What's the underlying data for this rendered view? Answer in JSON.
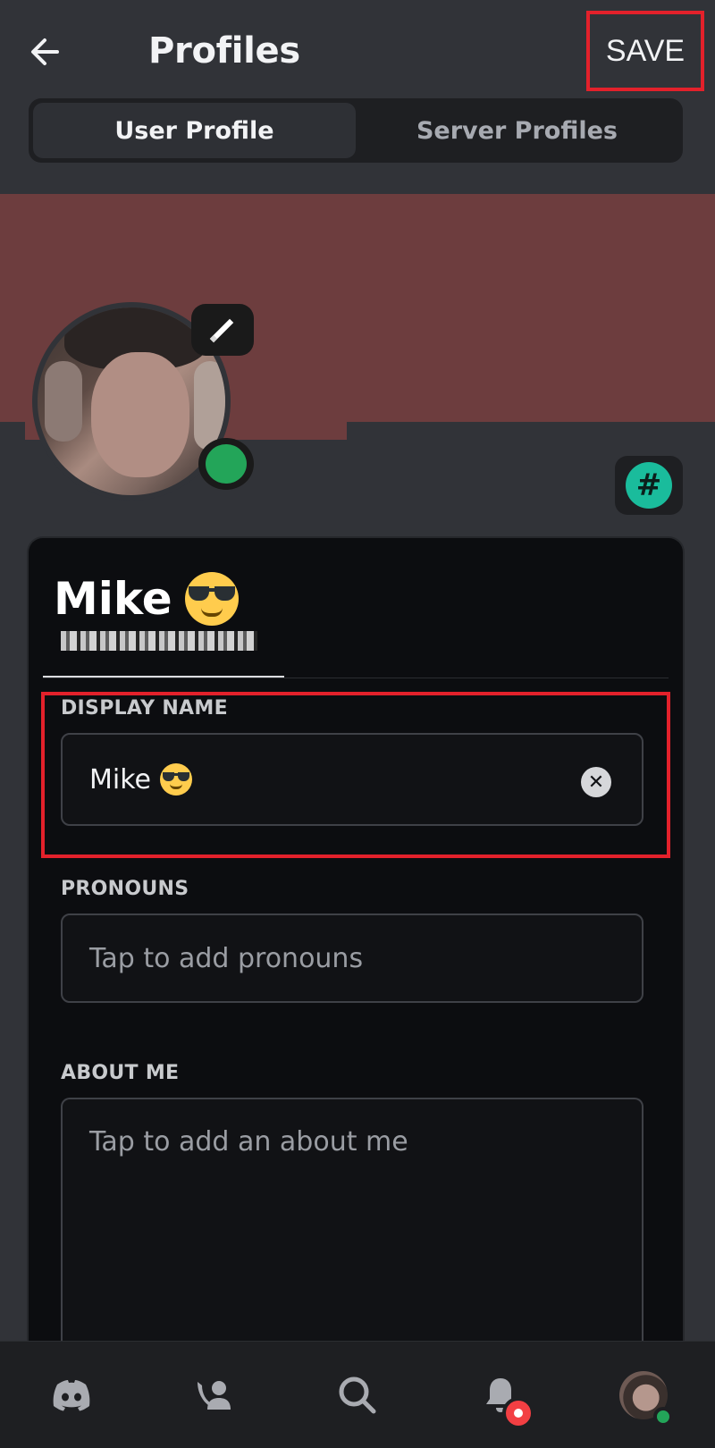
{
  "header": {
    "title": "Profiles",
    "save_label": "SAVE",
    "back_icon": "arrow-left-icon"
  },
  "tabs": [
    {
      "label": "User Profile",
      "active": true
    },
    {
      "label": "Server Profiles",
      "active": false
    }
  ],
  "profile": {
    "banner_color": "#6d3d3e",
    "name": "Mike",
    "name_emoji": "smiling-face-with-sunglasses",
    "status": "online",
    "status_color": "#23a559",
    "badge_symbol": "#",
    "badge_color": "#1abc9c"
  },
  "fields": {
    "display_name": {
      "label": "DISPLAY NAME",
      "value": "Mike"
    },
    "pronouns": {
      "label": "PRONOUNS",
      "placeholder": "Tap to add pronouns"
    },
    "about_me": {
      "label": "ABOUT ME",
      "placeholder": "Tap to add an about me"
    }
  },
  "highlight_color": "#e3212b",
  "bottom_nav": [
    {
      "icon": "discord-home-icon"
    },
    {
      "icon": "friends-icon"
    },
    {
      "icon": "search-icon"
    },
    {
      "icon": "notifications-bell-icon",
      "badge": true
    },
    {
      "icon": "user-avatar-icon",
      "status": "online"
    }
  ]
}
